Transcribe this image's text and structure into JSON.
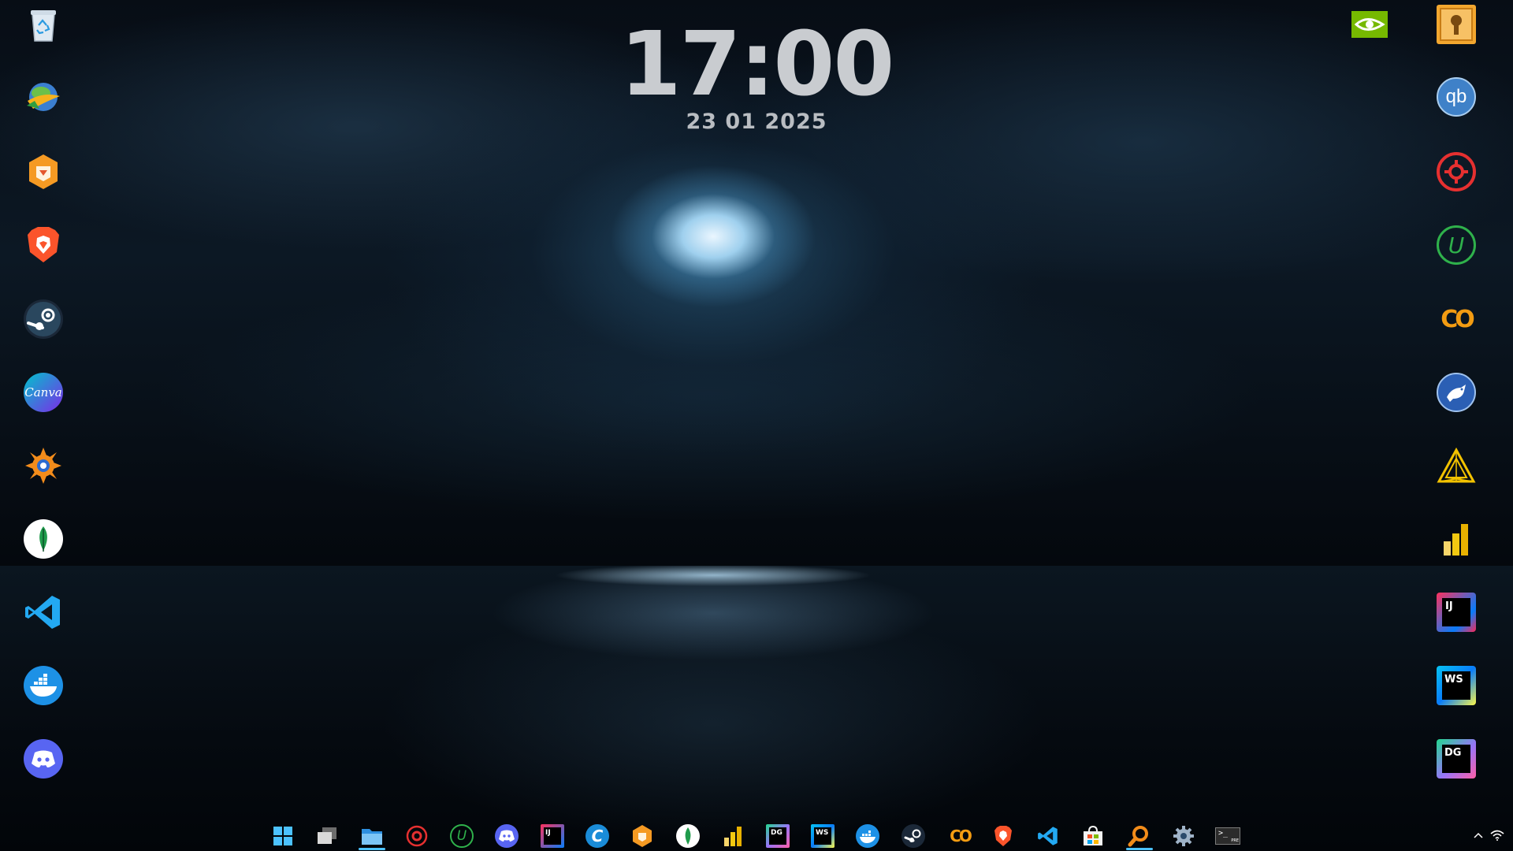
{
  "clock": {
    "time": "17:00",
    "date": "23 01 2025"
  },
  "desktop": {
    "left_column": [
      {
        "name": "recycle-bin-icon"
      },
      {
        "name": "internet-download-manager-icon"
      },
      {
        "name": "brave-orange-app-icon"
      },
      {
        "name": "brave-browser-icon"
      },
      {
        "name": "steam-icon"
      },
      {
        "name": "canva-icon",
        "label": "Canva"
      },
      {
        "name": "xnview-icon"
      },
      {
        "name": "mongodb-compass-icon"
      },
      {
        "name": "vscode-icon"
      },
      {
        "name": "docker-icon"
      },
      {
        "name": "discord-icon"
      }
    ],
    "right_column": [
      {
        "name": "nvidia-icon"
      },
      {
        "name": "keepass-icon"
      },
      {
        "name": "qbittorrent-icon",
        "label": "qb"
      },
      {
        "name": "red-gear-app-icon"
      },
      {
        "name": "upwork-icon",
        "label": "U"
      },
      {
        "name": "coursera-icon",
        "label": "CO"
      },
      {
        "name": "bird-app-icon"
      },
      {
        "name": "triangle-app-icon"
      },
      {
        "name": "power-bi-icon"
      },
      {
        "name": "intellij-idea-icon",
        "label": "IJ"
      },
      {
        "name": "webstorm-icon",
        "label": "WS"
      },
      {
        "name": "datagrip-icon",
        "label": "DG"
      }
    ]
  },
  "taskbar": {
    "items": [
      {
        "name": "start-icon"
      },
      {
        "name": "task-view-icon"
      },
      {
        "name": "file-explorer-icon"
      },
      {
        "name": "red-gear-app-icon"
      },
      {
        "name": "upwork-icon",
        "label": "U"
      },
      {
        "name": "discord-icon"
      },
      {
        "name": "intellij-idea-icon",
        "label": "IJ"
      },
      {
        "name": "cursor-app-icon",
        "label": "C"
      },
      {
        "name": "brave-orange-app-icon"
      },
      {
        "name": "mongodb-compass-icon"
      },
      {
        "name": "power-bi-icon"
      },
      {
        "name": "datagrip-icon",
        "label": "DG"
      },
      {
        "name": "webstorm-icon",
        "label": "WS"
      },
      {
        "name": "docker-icon"
      },
      {
        "name": "steam-icon"
      },
      {
        "name": "coursera-icon",
        "label": "CO"
      },
      {
        "name": "brave-browser-icon"
      },
      {
        "name": "vscode-icon"
      },
      {
        "name": "microsoft-store-icon"
      },
      {
        "name": "search-app-icon"
      },
      {
        "name": "settings-icon"
      },
      {
        "name": "terminal-icon",
        "label": "PRE"
      }
    ],
    "tray": [
      "chevron-up-icon",
      "wifi-icon"
    ]
  },
  "colors": {
    "clock": "#c9ccd0",
    "taskbar_indicator": "#4cc2ff"
  }
}
